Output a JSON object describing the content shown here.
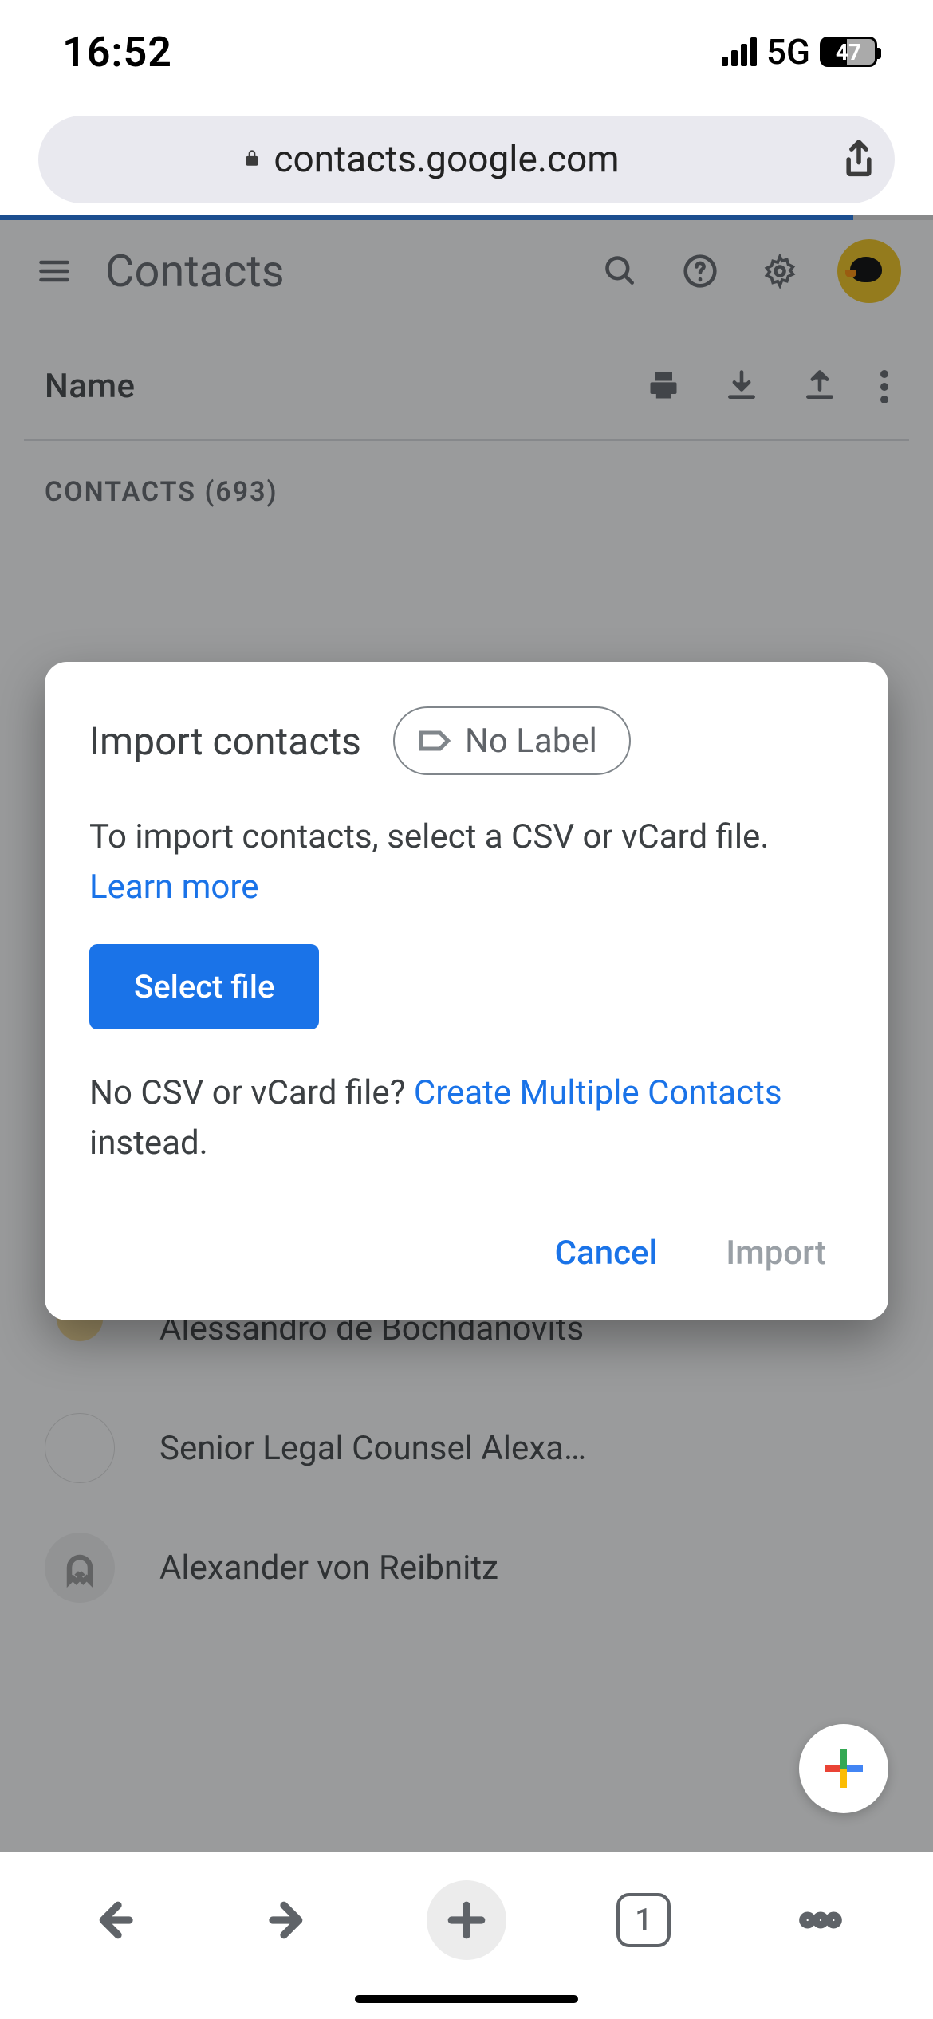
{
  "statusbar": {
    "time": "16:52",
    "network": "5G",
    "battery": "47"
  },
  "urlbar": {
    "url": "contacts.google.com"
  },
  "app": {
    "title": "Contacts",
    "column_header": "Name",
    "section_label": "CONTACTS (693)",
    "contacts_count": 693,
    "rows": [
      {
        "name": "Alessandro de Bochdanovits"
      },
      {
        "name": "Senior Legal Counsel Alexa…"
      },
      {
        "name": "Alexander von Reibnitz"
      }
    ]
  },
  "modal": {
    "title": "Import contacts",
    "label_chip": "No Label",
    "description": "To import contacts, select a CSV or vCard file.",
    "learn_more": "Learn more",
    "select_file": "Select file",
    "alt_prefix": "No CSV or vCard file? ",
    "alt_link": "Create Multiple Contacts",
    "alt_suffix": " instead.",
    "cancel": "Cancel",
    "import": "Import"
  },
  "browserbar": {
    "tab_count": "1"
  }
}
